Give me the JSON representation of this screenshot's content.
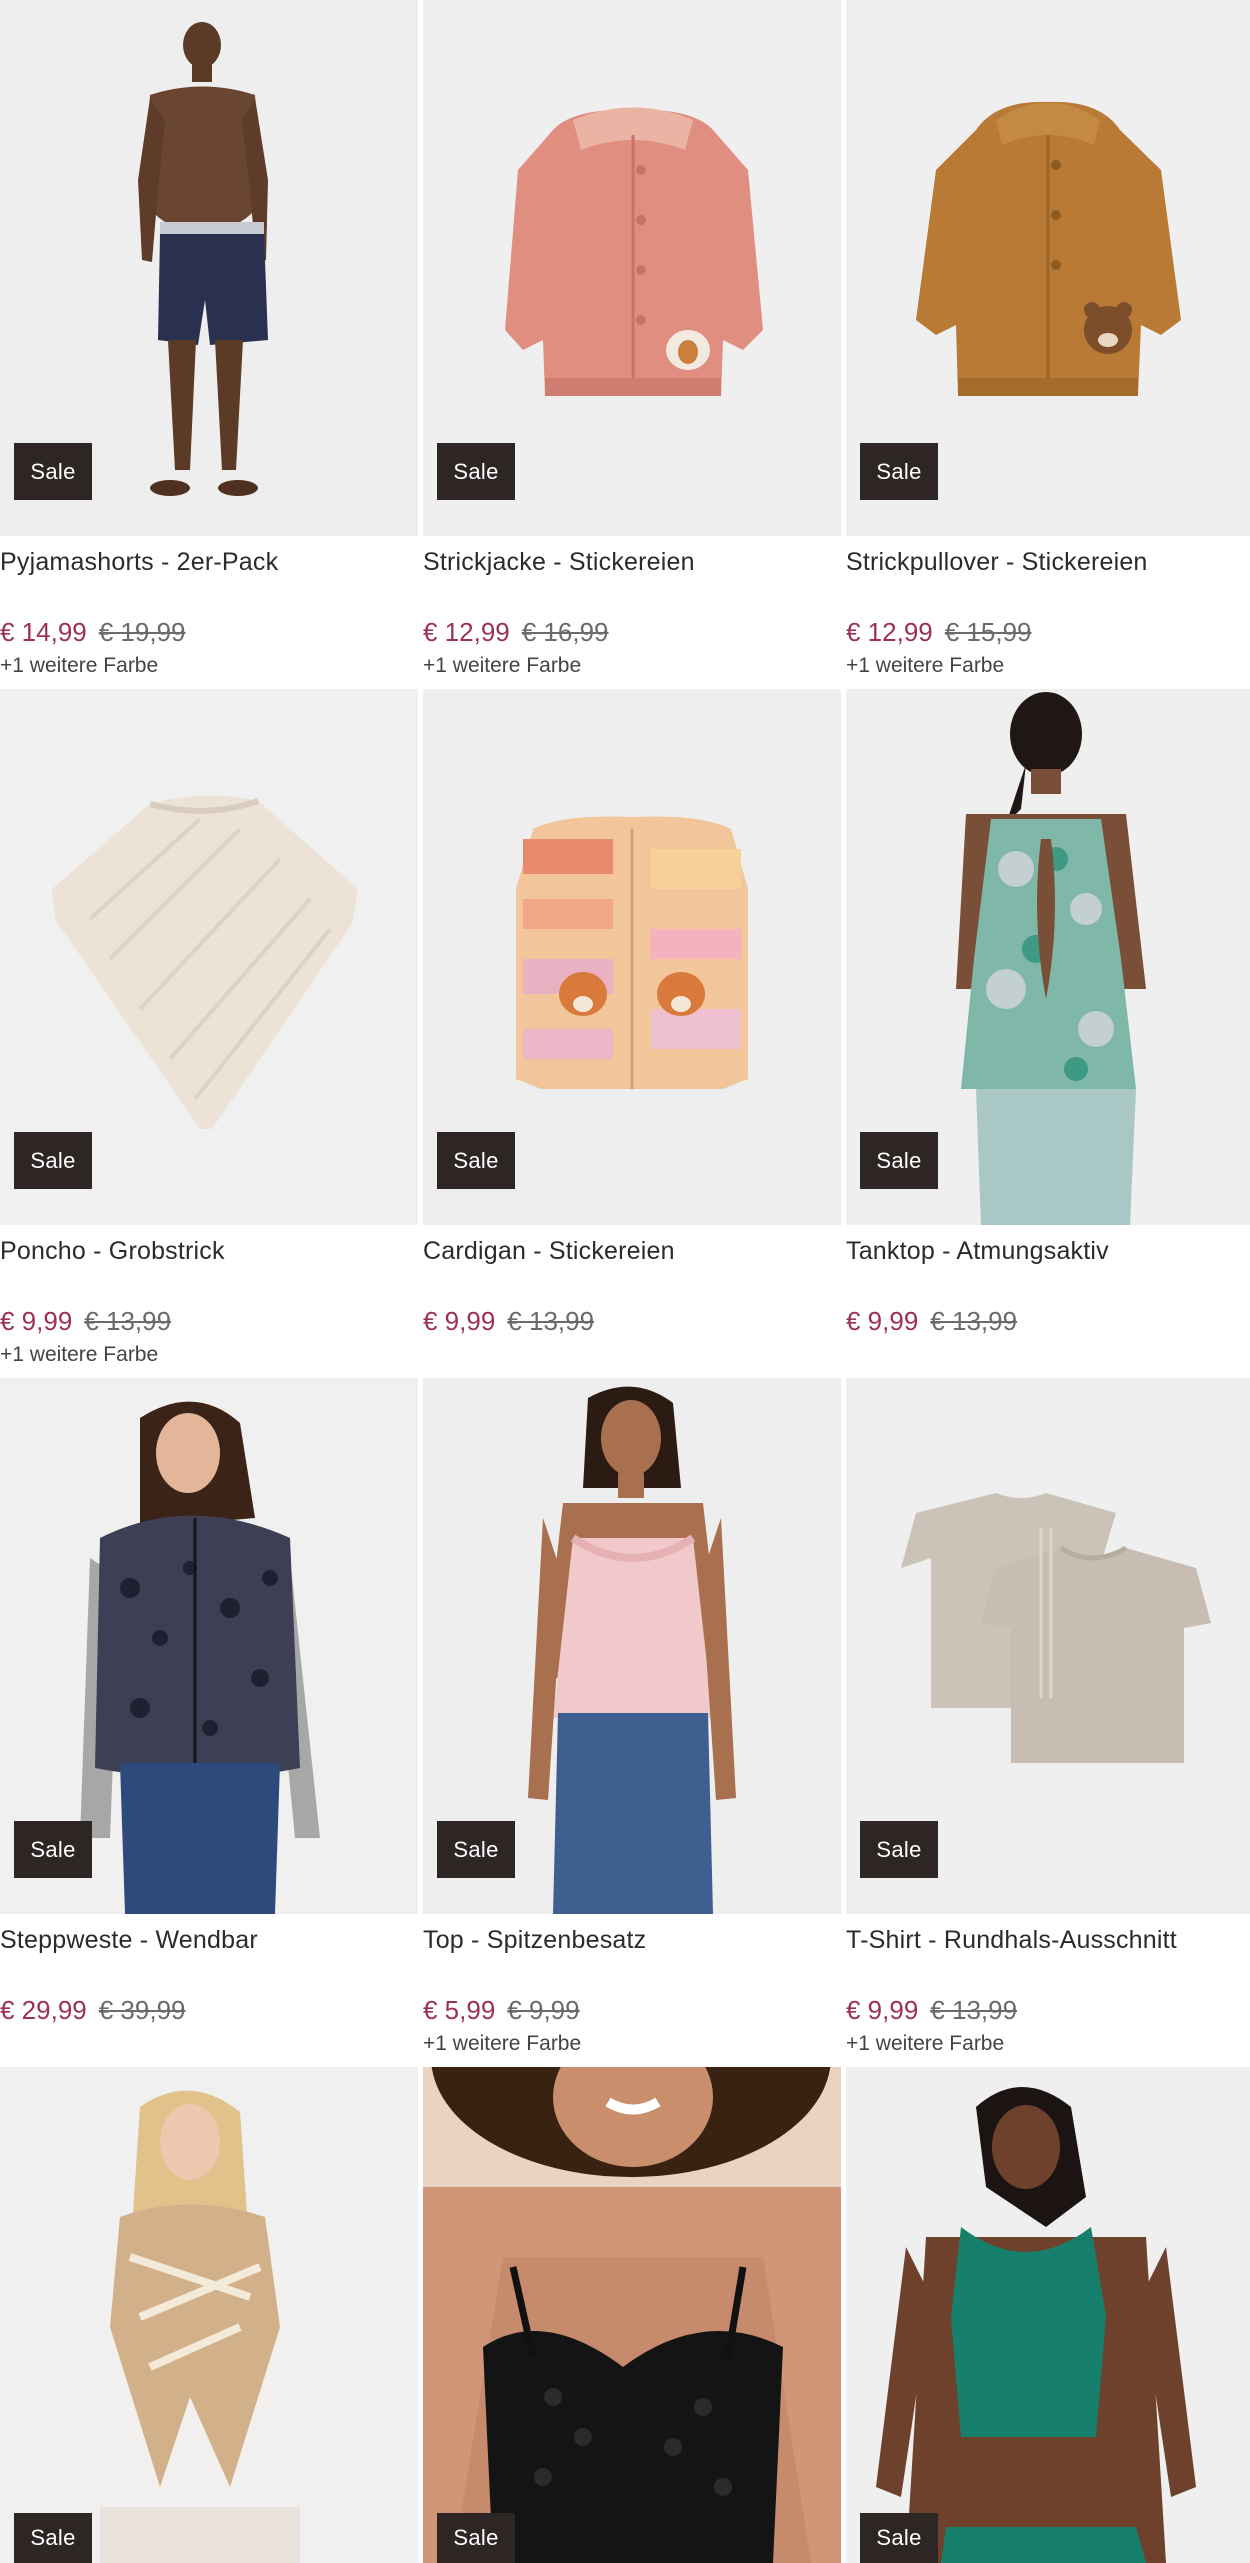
{
  "products": [
    {
      "title": "Pyjamashorts - 2er-Pack",
      "price": "€ 14,99",
      "old_price": "€ 19,99",
      "more": "+1 weitere Farbe",
      "badge": "Sale",
      "icon": "man-shorts-photo"
    },
    {
      "title": "Strickjacke - Stickereien",
      "price": "€ 12,99",
      "old_price": "€ 16,99",
      "more": "+1 weitere Farbe",
      "badge": "Sale",
      "icon": "pink-knit-jacket-photo"
    },
    {
      "title": "Strickpullover - Stickereien",
      "price": "€ 12,99",
      "old_price": "€ 15,99",
      "more": "+1 weitere Farbe",
      "badge": "Sale",
      "icon": "brown-knit-sweater-photo"
    },
    {
      "title": "Poncho - Grobstrick",
      "price": "€ 9,99",
      "old_price": "€ 13,99",
      "more": "+1 weitere Farbe",
      "badge": "Sale",
      "icon": "cream-poncho-photo"
    },
    {
      "title": "Cardigan - Stickereien",
      "price": "€ 9,99",
      "old_price": "€ 13,99",
      "more": "",
      "badge": "Sale",
      "icon": "striped-cardigan-photo"
    },
    {
      "title": "Tanktop - Atmungsaktiv",
      "price": "€ 9,99",
      "old_price": "€ 13,99",
      "more": "",
      "badge": "Sale",
      "icon": "tanktop-woman-photo"
    },
    {
      "title": "Steppweste - Wendbar",
      "price": "€ 29,99",
      "old_price": "€ 39,99",
      "more": "",
      "badge": "Sale",
      "icon": "woman-vest-photo"
    },
    {
      "title": "Top - Spitzenbesatz",
      "price": "€ 5,99",
      "old_price": "€ 9,99",
      "more": "+1 weitere Farbe",
      "badge": "Sale",
      "icon": "woman-pink-top-photo"
    },
    {
      "title": "T-Shirt - Rundhals-Ausschnitt",
      "price": "€ 9,99",
      "old_price": "€ 13,99",
      "more": "+1 weitere Farbe",
      "badge": "Sale",
      "icon": "beige-tshirts-photo"
    },
    {
      "title": "",
      "price": "",
      "old_price": "",
      "more": "",
      "badge": "Sale",
      "icon": "woman-scarf-photo"
    },
    {
      "title": "",
      "price": "",
      "old_price": "",
      "more": "",
      "badge": "Sale",
      "icon": "black-bra-photo"
    },
    {
      "title": "",
      "price": "",
      "old_price": "",
      "more": "",
      "badge": "Sale",
      "icon": "green-sports-top-photo"
    }
  ],
  "colors": {
    "sale_badge": "#2d2624",
    "price_now": "#9c3253",
    "price_old": "#6b6b6b"
  }
}
